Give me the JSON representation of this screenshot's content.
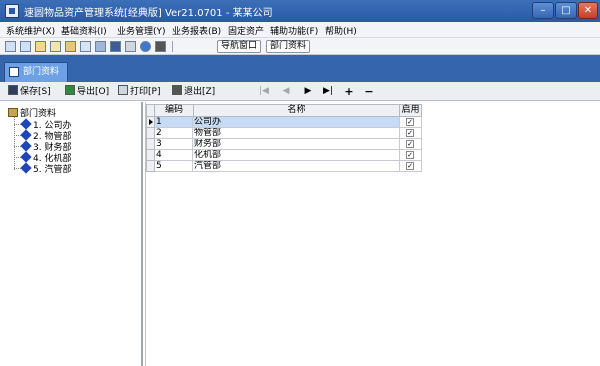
{
  "window": {
    "title": "速圆物品资产管理系统[经典版] Ver21.0701 - 某某公司",
    "min": "–",
    "max": "□",
    "close": "✕"
  },
  "menu": [
    "系统维护(X)",
    "基础资料(I)",
    "业务管理(Y)",
    "业务报表(B)",
    "固定资产",
    "辅助功能(F)",
    "帮助(H)"
  ],
  "toolbar": {
    "nav_window": "导航窗口",
    "dept_info": "部门资料"
  },
  "module_tab": "部门资料",
  "actions": {
    "save": "保存[S]",
    "export": "导出[O]",
    "print": "打印[P]",
    "exit": "退出[Z]"
  },
  "nav": {
    "first": "|◀",
    "prev": "◀",
    "next": "▶",
    "last": "▶|",
    "add": "+",
    "remove": "−"
  },
  "tree": {
    "root": "部门资料",
    "items": [
      "1. 公司办",
      "2. 物管部",
      "3. 财务部",
      "4. 化机部",
      "5. 汽管部"
    ]
  },
  "grid": {
    "headers": {
      "code": "编码",
      "name": "名称",
      "enabled": "启用"
    },
    "rows": [
      {
        "code": "1",
        "name": "公司办",
        "enabled": "✓"
      },
      {
        "code": "2",
        "name": "物管部",
        "enabled": "✓"
      },
      {
        "code": "3",
        "name": "财务部",
        "enabled": "✓"
      },
      {
        "code": "4",
        "name": "化机部",
        "enabled": "✓"
      },
      {
        "code": "5",
        "name": "汽管部",
        "enabled": "✓"
      }
    ]
  }
}
